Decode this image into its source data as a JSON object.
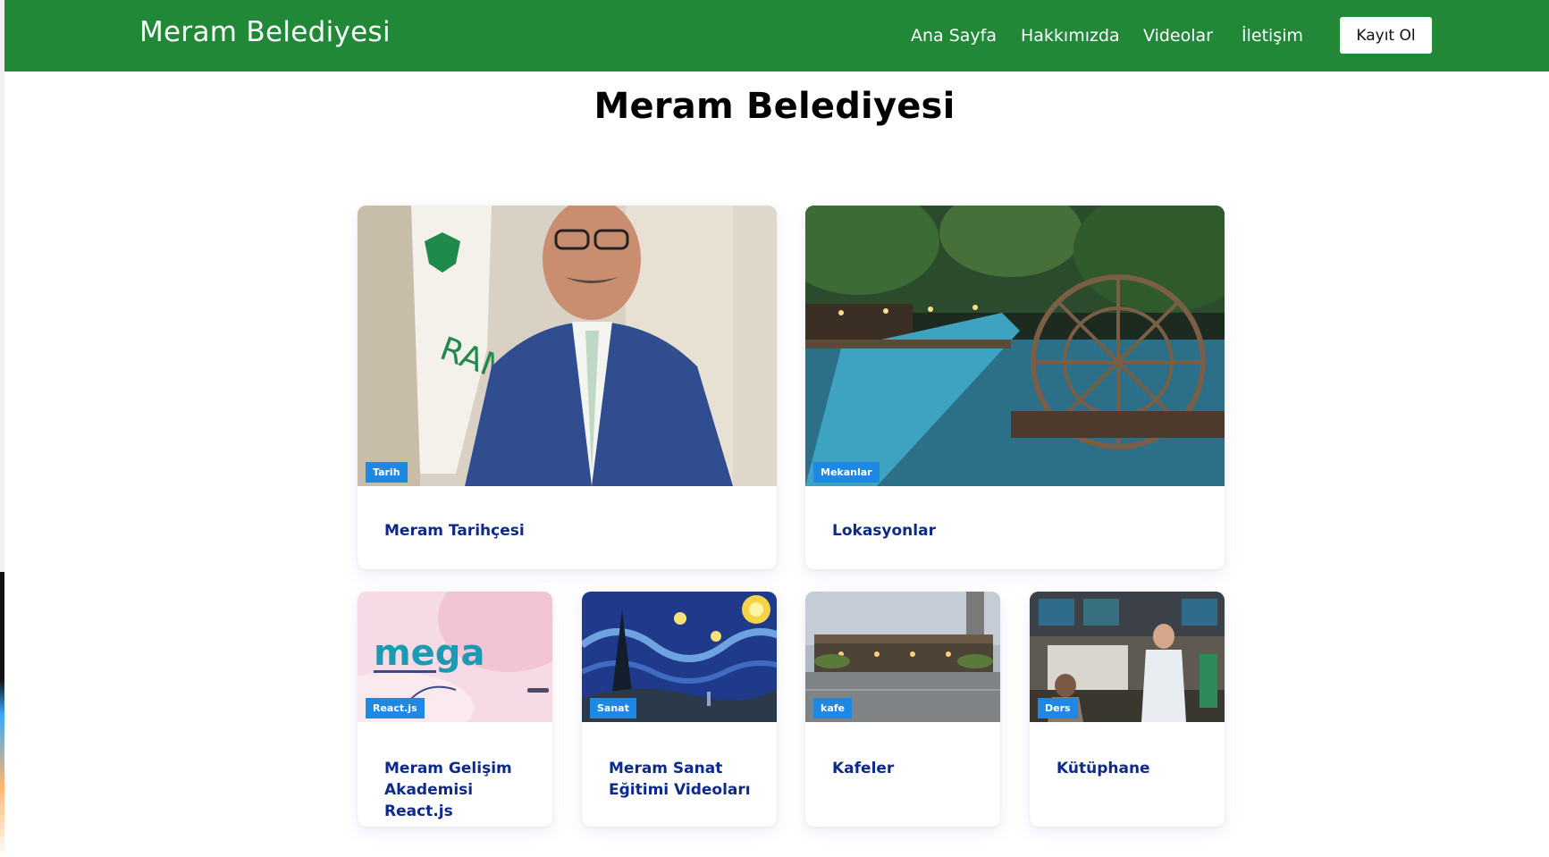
{
  "nav": {
    "brand": "Meram Belediyesi",
    "links": [
      "Ana Sayfa",
      "Hakkımızda",
      "Videolar",
      "İletişim"
    ],
    "register_label": "Kayıt Ol"
  },
  "page": {
    "title": "Meram Belediyesi"
  },
  "cards": [
    {
      "badge": "Tarih",
      "title": "Meram Tarihçesi"
    },
    {
      "badge": "Mekanlar",
      "title": "Lokasyonlar"
    },
    {
      "badge": "React.js",
      "title": "Meram Gelişim Akademisi React.js",
      "image_text": "mega"
    },
    {
      "badge": "Sanat",
      "title": "Meram Sanat Eğitimi Videoları"
    },
    {
      "badge": "kafe",
      "title": "Kafeler"
    },
    {
      "badge": "Ders",
      "title": "Kütüphane"
    }
  ],
  "colors": {
    "navbar": "#218838",
    "badge": "#1e88e5",
    "card_title": "#0d2a8a"
  }
}
